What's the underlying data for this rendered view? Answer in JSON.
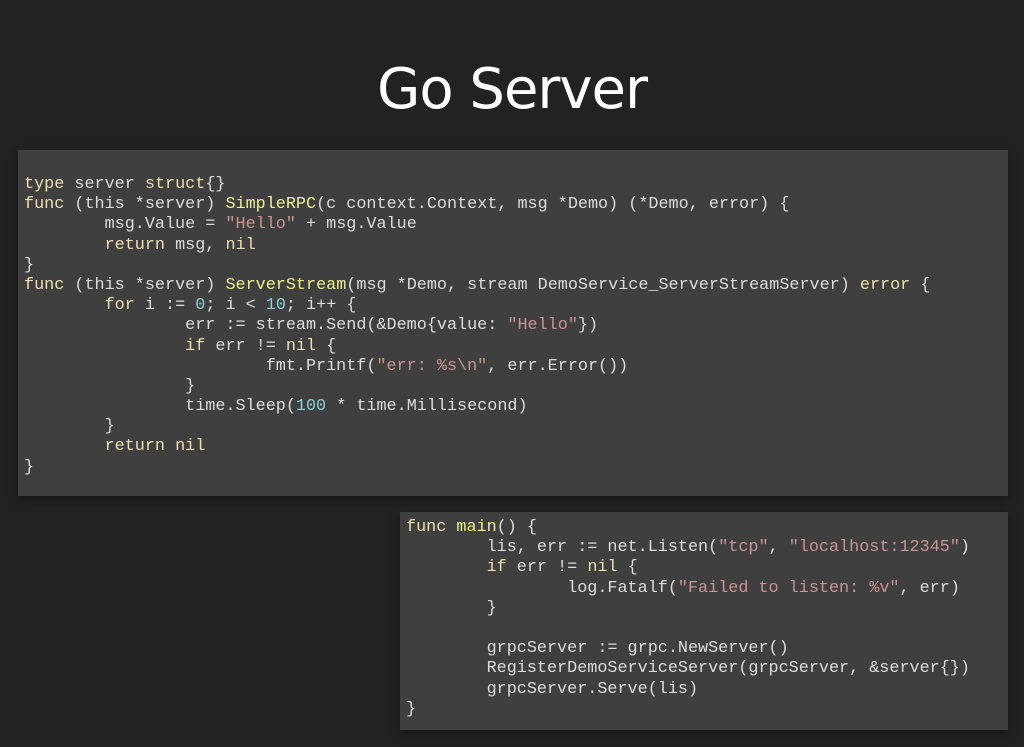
{
  "slide": {
    "title": "Go Server"
  },
  "colors": {
    "background": "#222222",
    "code_background": "#3f3f3f",
    "keyword": "#f0dfaf",
    "function_name": "#efef8f",
    "string": "#cc9393",
    "number": "#8cd0d3",
    "plain": "#dcdcdc"
  },
  "code_blocks": [
    {
      "name": "server-methods",
      "lines": [
        [
          [
            "kw",
            "type"
          ],
          [
            "plain",
            " server "
          ],
          [
            "kw",
            "struct"
          ],
          [
            "plain",
            "{}"
          ]
        ],
        [
          [
            "kw",
            "func"
          ],
          [
            "plain",
            " (this *server) "
          ],
          [
            "fn",
            "SimpleRPC"
          ],
          [
            "plain",
            "(c context.Context, msg *Demo) (*Demo, error) {"
          ]
        ],
        [
          [
            "plain",
            "        msg.Value = "
          ],
          [
            "str",
            "\"Hello\""
          ],
          [
            "plain",
            " + msg.Value"
          ]
        ],
        [
          [
            "plain",
            "        "
          ],
          [
            "kw",
            "return"
          ],
          [
            "plain",
            " msg, "
          ],
          [
            "kw",
            "nil"
          ]
        ],
        [
          [
            "plain",
            "}"
          ]
        ],
        [
          [
            "kw",
            "func"
          ],
          [
            "plain",
            " (this *server) "
          ],
          [
            "fn",
            "ServerStream"
          ],
          [
            "plain",
            "(msg *Demo, stream DemoService_ServerStreamServer) "
          ],
          [
            "kw",
            "error"
          ],
          [
            "plain",
            " {"
          ]
        ],
        [
          [
            "plain",
            "        "
          ],
          [
            "kw",
            "for"
          ],
          [
            "plain",
            " i := "
          ],
          [
            "num",
            "0"
          ],
          [
            "plain",
            "; i < "
          ],
          [
            "num",
            "10"
          ],
          [
            "plain",
            "; i++ {"
          ]
        ],
        [
          [
            "plain",
            "                err := stream.Send(&Demo{value: "
          ],
          [
            "str",
            "\"Hello\""
          ],
          [
            "plain",
            "})"
          ]
        ],
        [
          [
            "plain",
            "                "
          ],
          [
            "kw",
            "if"
          ],
          [
            "plain",
            " err != "
          ],
          [
            "kw",
            "nil"
          ],
          [
            "plain",
            " {"
          ]
        ],
        [
          [
            "plain",
            "                        fmt.Printf("
          ],
          [
            "str",
            "\"err: %s\\n\""
          ],
          [
            "plain",
            ", err.Error())"
          ]
        ],
        [
          [
            "plain",
            "                }"
          ]
        ],
        [
          [
            "plain",
            "                time.Sleep("
          ],
          [
            "num",
            "100"
          ],
          [
            "plain",
            " * time.Millisecond)"
          ]
        ],
        [
          [
            "plain",
            "        }"
          ]
        ],
        [
          [
            "plain",
            "        "
          ],
          [
            "kw",
            "return"
          ],
          [
            "plain",
            " "
          ],
          [
            "kw",
            "nil"
          ]
        ],
        [
          [
            "plain",
            "}"
          ]
        ]
      ]
    },
    {
      "name": "main-function",
      "lines": [
        [
          [
            "kw",
            "func"
          ],
          [
            "plain",
            " "
          ],
          [
            "fn",
            "main"
          ],
          [
            "plain",
            "() {"
          ]
        ],
        [
          [
            "plain",
            "        lis, err := net.Listen("
          ],
          [
            "str",
            "\"tcp\""
          ],
          [
            "plain",
            ", "
          ],
          [
            "str",
            "\"localhost:12345\""
          ],
          [
            "plain",
            ")"
          ]
        ],
        [
          [
            "plain",
            "        "
          ],
          [
            "kw",
            "if"
          ],
          [
            "plain",
            " err != "
          ],
          [
            "kw",
            "nil"
          ],
          [
            "plain",
            " {"
          ]
        ],
        [
          [
            "plain",
            "                log.Fatalf("
          ],
          [
            "str",
            "\"Failed to listen: %v\""
          ],
          [
            "plain",
            ", err)"
          ]
        ],
        [
          [
            "plain",
            "        }"
          ]
        ],
        [
          [
            "plain",
            ""
          ]
        ],
        [
          [
            "plain",
            "        grpcServer := grpc.NewServer()"
          ]
        ],
        [
          [
            "plain",
            "        RegisterDemoServiceServer(grpcServer, &server{})"
          ]
        ],
        [
          [
            "plain",
            "        grpcServer.Serve(lis)"
          ]
        ],
        [
          [
            "plain",
            "}"
          ]
        ]
      ]
    }
  ]
}
